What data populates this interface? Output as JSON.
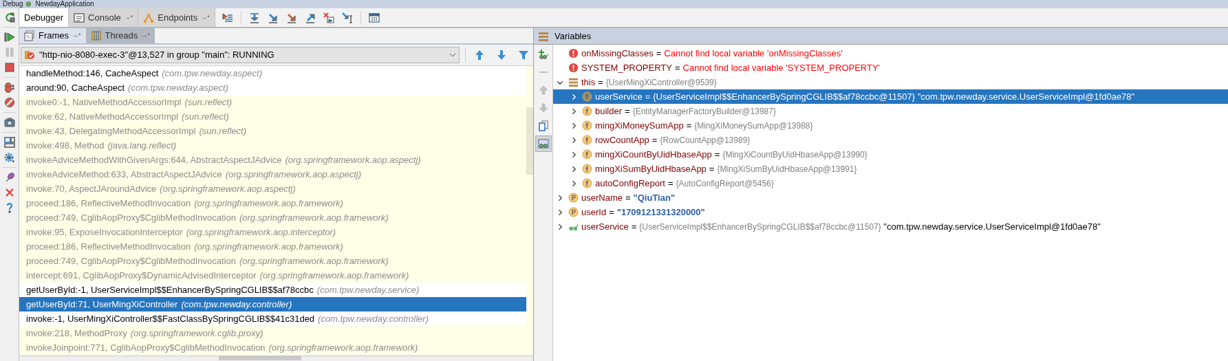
{
  "window": {
    "title_parts": [
      "Debug",
      "NewdayApplication"
    ]
  },
  "side_toolbar": [
    {
      "kind": "rerun",
      "disabled": false
    },
    {
      "kind": "resume",
      "disabled": false
    },
    {
      "kind": "pause",
      "disabled": true
    },
    {
      "kind": "stop",
      "disabled": false
    },
    {
      "kind": "breakpoints",
      "disabled": false
    },
    {
      "kind": "mute",
      "disabled": false
    },
    {
      "kind": "camera",
      "disabled": false
    },
    {
      "kind": "layout",
      "disabled": false
    },
    {
      "kind": "settings",
      "disabled": false
    },
    {
      "kind": "pin",
      "disabled": false
    },
    {
      "kind": "close",
      "disabled": false
    },
    {
      "kind": "help",
      "disabled": false
    }
  ],
  "tabs": [
    {
      "label": "Debugger",
      "selected": true,
      "kind": "plain"
    },
    {
      "label": "Console",
      "selected": false,
      "kind": "console",
      "pin": "→*"
    },
    {
      "label": "Endpoints",
      "selected": false,
      "kind": "endpoints",
      "pin": "→*"
    }
  ],
  "step_toolbar": [
    {
      "kind": "show-execution-point"
    },
    {
      "kind": "step-over"
    },
    {
      "kind": "step-into"
    },
    {
      "kind": "force-step-into"
    },
    {
      "kind": "step-out"
    },
    {
      "kind": "drop-frame"
    },
    {
      "kind": "run-to-cursor"
    },
    {
      "kind": "evaluate"
    }
  ],
  "frames_tabs": [
    {
      "label": "Frames",
      "selected": true,
      "kind": "frames",
      "pin": "→*"
    },
    {
      "label": "Threads",
      "selected": false,
      "kind": "threads",
      "pin": "→*"
    }
  ],
  "thread_selector": {
    "value": "\"http-nio-8080-exec-3\"@13,527 in group \"main\": RUNNING"
  },
  "frames": [
    {
      "method": "handleMethod:146, CacheAspect",
      "package": "(com.tpw.newday.aspect)",
      "library": false,
      "selected": false
    },
    {
      "method": "around:90, CacheAspect",
      "package": "(com.tpw.newday.aspect)",
      "library": false,
      "selected": false
    },
    {
      "method": "invoke0:-1, NativeMethodAccessorImpl",
      "package": "(sun.reflect)",
      "library": true,
      "selected": false
    },
    {
      "method": "invoke:62, NativeMethodAccessorImpl",
      "package": "(sun.reflect)",
      "library": true,
      "selected": false
    },
    {
      "method": "invoke:43, DelegatingMethodAccessorImpl",
      "package": "(sun.reflect)",
      "library": true,
      "selected": false
    },
    {
      "method": "invoke:498, Method",
      "package": "(java.lang.reflect)",
      "library": true,
      "selected": false
    },
    {
      "method": "invokeAdviceMethodWithGivenArgs:644, AbstractAspectJAdvice",
      "package": "(org.springframework.aop.aspectj)",
      "library": true,
      "selected": false
    },
    {
      "method": "invokeAdviceMethod:633, AbstractAspectJAdvice",
      "package": "(org.springframework.aop.aspectj)",
      "library": true,
      "selected": false
    },
    {
      "method": "invoke:70, AspectJAroundAdvice",
      "package": "(org.springframework.aop.aspectj)",
      "library": true,
      "selected": false
    },
    {
      "method": "proceed:186, ReflectiveMethodInvocation",
      "package": "(org.springframework.aop.framework)",
      "library": true,
      "selected": false
    },
    {
      "method": "proceed:749, CglibAopProxy$CglibMethodInvocation",
      "package": "(org.springframework.aop.framework)",
      "library": true,
      "selected": false
    },
    {
      "method": "invoke:95, ExposeInvocationInterceptor",
      "package": "(org.springframework.aop.interceptor)",
      "library": true,
      "selected": false
    },
    {
      "method": "proceed:186, ReflectiveMethodInvocation",
      "package": "(org.springframework.aop.framework)",
      "library": true,
      "selected": false
    },
    {
      "method": "proceed:749, CglibAopProxy$CglibMethodInvocation",
      "package": "(org.springframework.aop.framework)",
      "library": true,
      "selected": false
    },
    {
      "method": "intercept:691, CglibAopProxy$DynamicAdvisedInterceptor",
      "package": "(org.springframework.aop.framework)",
      "library": true,
      "selected": false
    },
    {
      "method": "getUserById:-1, UserServiceImpl$$EnhancerBySpringCGLIB$$af78ccbc",
      "package": "(com.tpw.newday.service)",
      "library": false,
      "selected": false
    },
    {
      "method": "getUserById:71, UserMingXiController",
      "package": "(com.tpw.newday.controller)",
      "library": false,
      "selected": true
    },
    {
      "method": "invoke:-1, UserMingXiController$$FastClassBySpringCGLIB$$41c31ded",
      "package": "(com.tpw.newday.controller)",
      "library": false,
      "selected": false
    },
    {
      "method": "invoke:218, MethodProxy",
      "package": "(org.springframework.cglib.proxy)",
      "library": true,
      "selected": false
    },
    {
      "method": "invokeJoinpoint:771, CglibAopProxy$CglibMethodInvocation",
      "package": "(org.springframework.aop.framework)",
      "library": true,
      "selected": false
    }
  ],
  "variables_panel": {
    "title": "Variables"
  },
  "variables_toolbar": [
    {
      "kind": "new-watch",
      "disabled": false
    },
    {
      "kind": "remove",
      "disabled": true
    },
    {
      "kind": "up",
      "disabled": true
    },
    {
      "kind": "down",
      "disabled": true
    },
    {
      "kind": "copy",
      "disabled": false
    },
    {
      "kind": "show-watches",
      "disabled": false
    }
  ],
  "variables": [
    {
      "kind": "error",
      "name": "onMissingClasses",
      "op": "=",
      "value": "Cannot find local variable 'onMissingClasses'",
      "selected": false
    },
    {
      "kind": "error",
      "name": "SYSTEM_PROPERTY",
      "op": "=",
      "value": "Cannot find local variable 'SYSTEM_PROPERTY'",
      "selected": false
    },
    {
      "kind": "object",
      "name": "this",
      "op": "=",
      "value": "{UserMingXiController@9539}",
      "is_string": false,
      "selected": false,
      "expanded": true,
      "children": [
        {
          "kind": "field",
          "name": "userService",
          "op": "=",
          "value": "{UserServiceImpl$$EnhancerBySpringCGLIB$$af78ccbc@11507}",
          "string_value": "\"com.tpw.newday.service.UserServiceImpl@1fd0ae78\"",
          "is_string": false,
          "selected": true,
          "expanded": false
        },
        {
          "kind": "field",
          "name": "builder",
          "op": "=",
          "value": "{EntityManagerFactoryBuilder@13987}",
          "is_string": false,
          "selected": false,
          "expanded": false
        },
        {
          "kind": "field",
          "name": "mingXiMoneySumApp",
          "op": "=",
          "value": "{MingXiMoneySumApp@13988}",
          "is_string": false,
          "selected": false,
          "expanded": false
        },
        {
          "kind": "field",
          "name": "rowCountApp",
          "op": "=",
          "value": "{RowCountApp@13989}",
          "is_string": false,
          "selected": false,
          "expanded": false
        },
        {
          "kind": "field",
          "name": "mingXiCountByUidHbaseApp",
          "op": "=",
          "value": "{MingXiCountByUidHbaseApp@13990}",
          "is_string": false,
          "selected": false,
          "expanded": false
        },
        {
          "kind": "field",
          "name": "mingXiSumByUidHbaseApp",
          "op": "=",
          "value": "{MingXiSumByUidHbaseApp@13991}",
          "is_string": false,
          "selected": false,
          "expanded": false
        },
        {
          "kind": "field",
          "name": "autoConfigReport",
          "op": "=",
          "value": "{AutoConfigReport@5456}",
          "is_string": false,
          "selected": false,
          "expanded": false
        }
      ]
    },
    {
      "kind": "param",
      "name": "userName",
      "op": "=",
      "value": "\"QiuTian\"",
      "is_string": true,
      "selected": false,
      "expanded": false
    },
    {
      "kind": "param",
      "name": "userId",
      "op": "=",
      "value": "\"1709121331320000\"",
      "is_string": true,
      "selected": false,
      "expanded": false
    },
    {
      "kind": "watch",
      "name": "userService",
      "op": "=",
      "value": "{UserServiceImpl$$EnhancerBySpringCGLIB$$af78ccbc@11507}",
      "string_value": "\"com.tpw.newday.service.UserServiceImpl@1fd0ae78\"",
      "is_string": false,
      "selected": false,
      "expanded": false
    }
  ]
}
